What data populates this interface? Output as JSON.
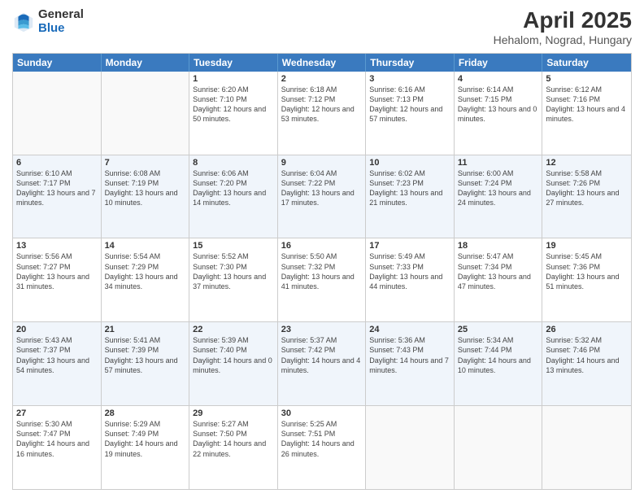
{
  "header": {
    "logo_general": "General",
    "logo_blue": "Blue",
    "month_title": "April 2025",
    "location": "Hehalom, Nograd, Hungary"
  },
  "weekdays": [
    "Sunday",
    "Monday",
    "Tuesday",
    "Wednesday",
    "Thursday",
    "Friday",
    "Saturday"
  ],
  "rows": [
    [
      {
        "day": "",
        "sunrise": "",
        "sunset": "",
        "daylight": ""
      },
      {
        "day": "",
        "sunrise": "",
        "sunset": "",
        "daylight": ""
      },
      {
        "day": "1",
        "sunrise": "Sunrise: 6:20 AM",
        "sunset": "Sunset: 7:10 PM",
        "daylight": "Daylight: 12 hours and 50 minutes."
      },
      {
        "day": "2",
        "sunrise": "Sunrise: 6:18 AM",
        "sunset": "Sunset: 7:12 PM",
        "daylight": "Daylight: 12 hours and 53 minutes."
      },
      {
        "day": "3",
        "sunrise": "Sunrise: 6:16 AM",
        "sunset": "Sunset: 7:13 PM",
        "daylight": "Daylight: 12 hours and 57 minutes."
      },
      {
        "day": "4",
        "sunrise": "Sunrise: 6:14 AM",
        "sunset": "Sunset: 7:15 PM",
        "daylight": "Daylight: 13 hours and 0 minutes."
      },
      {
        "day": "5",
        "sunrise": "Sunrise: 6:12 AM",
        "sunset": "Sunset: 7:16 PM",
        "daylight": "Daylight: 13 hours and 4 minutes."
      }
    ],
    [
      {
        "day": "6",
        "sunrise": "Sunrise: 6:10 AM",
        "sunset": "Sunset: 7:17 PM",
        "daylight": "Daylight: 13 hours and 7 minutes."
      },
      {
        "day": "7",
        "sunrise": "Sunrise: 6:08 AM",
        "sunset": "Sunset: 7:19 PM",
        "daylight": "Daylight: 13 hours and 10 minutes."
      },
      {
        "day": "8",
        "sunrise": "Sunrise: 6:06 AM",
        "sunset": "Sunset: 7:20 PM",
        "daylight": "Daylight: 13 hours and 14 minutes."
      },
      {
        "day": "9",
        "sunrise": "Sunrise: 6:04 AM",
        "sunset": "Sunset: 7:22 PM",
        "daylight": "Daylight: 13 hours and 17 minutes."
      },
      {
        "day": "10",
        "sunrise": "Sunrise: 6:02 AM",
        "sunset": "Sunset: 7:23 PM",
        "daylight": "Daylight: 13 hours and 21 minutes."
      },
      {
        "day": "11",
        "sunrise": "Sunrise: 6:00 AM",
        "sunset": "Sunset: 7:24 PM",
        "daylight": "Daylight: 13 hours and 24 minutes."
      },
      {
        "day": "12",
        "sunrise": "Sunrise: 5:58 AM",
        "sunset": "Sunset: 7:26 PM",
        "daylight": "Daylight: 13 hours and 27 minutes."
      }
    ],
    [
      {
        "day": "13",
        "sunrise": "Sunrise: 5:56 AM",
        "sunset": "Sunset: 7:27 PM",
        "daylight": "Daylight: 13 hours and 31 minutes."
      },
      {
        "day": "14",
        "sunrise": "Sunrise: 5:54 AM",
        "sunset": "Sunset: 7:29 PM",
        "daylight": "Daylight: 13 hours and 34 minutes."
      },
      {
        "day": "15",
        "sunrise": "Sunrise: 5:52 AM",
        "sunset": "Sunset: 7:30 PM",
        "daylight": "Daylight: 13 hours and 37 minutes."
      },
      {
        "day": "16",
        "sunrise": "Sunrise: 5:50 AM",
        "sunset": "Sunset: 7:32 PM",
        "daylight": "Daylight: 13 hours and 41 minutes."
      },
      {
        "day": "17",
        "sunrise": "Sunrise: 5:49 AM",
        "sunset": "Sunset: 7:33 PM",
        "daylight": "Daylight: 13 hours and 44 minutes."
      },
      {
        "day": "18",
        "sunrise": "Sunrise: 5:47 AM",
        "sunset": "Sunset: 7:34 PM",
        "daylight": "Daylight: 13 hours and 47 minutes."
      },
      {
        "day": "19",
        "sunrise": "Sunrise: 5:45 AM",
        "sunset": "Sunset: 7:36 PM",
        "daylight": "Daylight: 13 hours and 51 minutes."
      }
    ],
    [
      {
        "day": "20",
        "sunrise": "Sunrise: 5:43 AM",
        "sunset": "Sunset: 7:37 PM",
        "daylight": "Daylight: 13 hours and 54 minutes."
      },
      {
        "day": "21",
        "sunrise": "Sunrise: 5:41 AM",
        "sunset": "Sunset: 7:39 PM",
        "daylight": "Daylight: 13 hours and 57 minutes."
      },
      {
        "day": "22",
        "sunrise": "Sunrise: 5:39 AM",
        "sunset": "Sunset: 7:40 PM",
        "daylight": "Daylight: 14 hours and 0 minutes."
      },
      {
        "day": "23",
        "sunrise": "Sunrise: 5:37 AM",
        "sunset": "Sunset: 7:42 PM",
        "daylight": "Daylight: 14 hours and 4 minutes."
      },
      {
        "day": "24",
        "sunrise": "Sunrise: 5:36 AM",
        "sunset": "Sunset: 7:43 PM",
        "daylight": "Daylight: 14 hours and 7 minutes."
      },
      {
        "day": "25",
        "sunrise": "Sunrise: 5:34 AM",
        "sunset": "Sunset: 7:44 PM",
        "daylight": "Daylight: 14 hours and 10 minutes."
      },
      {
        "day": "26",
        "sunrise": "Sunrise: 5:32 AM",
        "sunset": "Sunset: 7:46 PM",
        "daylight": "Daylight: 14 hours and 13 minutes."
      }
    ],
    [
      {
        "day": "27",
        "sunrise": "Sunrise: 5:30 AM",
        "sunset": "Sunset: 7:47 PM",
        "daylight": "Daylight: 14 hours and 16 minutes."
      },
      {
        "day": "28",
        "sunrise": "Sunrise: 5:29 AM",
        "sunset": "Sunset: 7:49 PM",
        "daylight": "Daylight: 14 hours and 19 minutes."
      },
      {
        "day": "29",
        "sunrise": "Sunrise: 5:27 AM",
        "sunset": "Sunset: 7:50 PM",
        "daylight": "Daylight: 14 hours and 22 minutes."
      },
      {
        "day": "30",
        "sunrise": "Sunrise: 5:25 AM",
        "sunset": "Sunset: 7:51 PM",
        "daylight": "Daylight: 14 hours and 26 minutes."
      },
      {
        "day": "",
        "sunrise": "",
        "sunset": "",
        "daylight": ""
      },
      {
        "day": "",
        "sunrise": "",
        "sunset": "",
        "daylight": ""
      },
      {
        "day": "",
        "sunrise": "",
        "sunset": "",
        "daylight": ""
      }
    ]
  ]
}
